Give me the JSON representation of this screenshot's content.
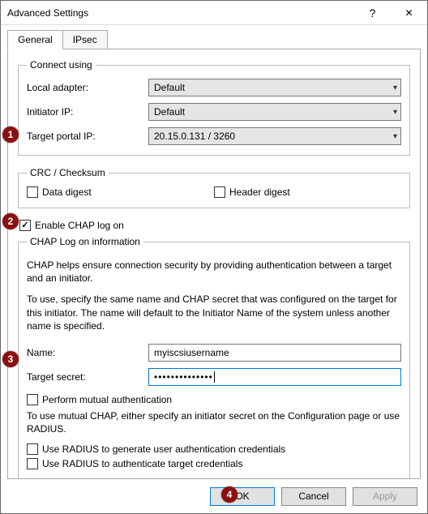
{
  "window": {
    "title": "Advanced Settings"
  },
  "tabs": {
    "general": "General",
    "ipsec": "IPsec"
  },
  "connect_using": {
    "legend": "Connect using",
    "local_adapter_label": "Local adapter:",
    "local_adapter_value": "Default",
    "initiator_ip_label": "Initiator IP:",
    "initiator_ip_value": "Default",
    "target_portal_ip_label": "Target portal IP:",
    "target_portal_ip_value": "20.15.0.131 / 3260"
  },
  "crc": {
    "legend": "CRC / Checksum",
    "data_digest": "Data digest",
    "header_digest": "Header digest"
  },
  "chap": {
    "enable_label": "Enable CHAP log on",
    "legend": "CHAP Log on information",
    "desc1": "CHAP helps ensure connection security by providing authentication between a target and an initiator.",
    "desc2": "To use, specify the same name and CHAP secret that was configured on the target for this initiator.  The name will default to the Initiator Name of the system unless another name is specified.",
    "name_label": "Name:",
    "name_value": "myiscsiusername",
    "secret_label": "Target secret:",
    "secret_value": "••••••••••••••",
    "mutual_label": "Perform mutual authentication",
    "mutual_desc": "To use mutual CHAP, either specify an initiator secret on the Configuration page or use RADIUS.",
    "radius1": "Use RADIUS to generate user authentication credentials",
    "radius2": "Use RADIUS to authenticate target credentials"
  },
  "buttons": {
    "ok": "OK",
    "cancel": "Cancel",
    "apply": "Apply"
  },
  "callouts": {
    "c1": "1",
    "c2": "2",
    "c3": "3",
    "c4": "4"
  }
}
